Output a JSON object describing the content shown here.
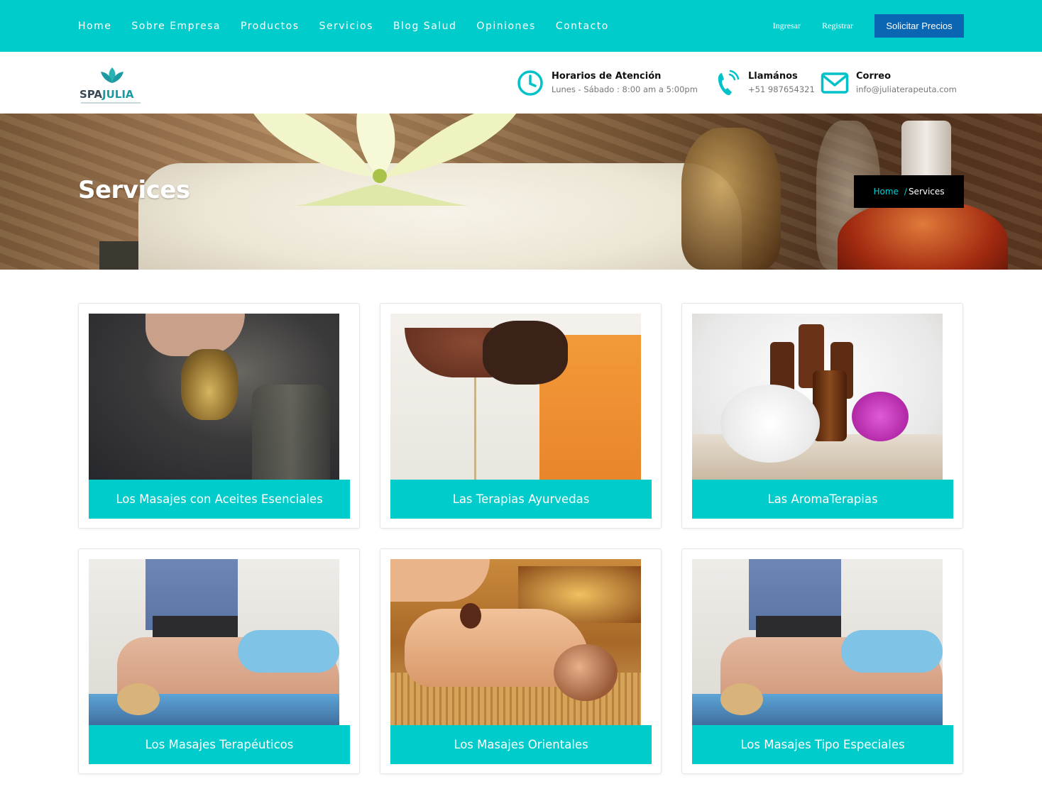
{
  "colors": {
    "brand": "#00cccc",
    "cta": "#0a66b3",
    "crumb_bg": "#000000",
    "crumb_accent": "#00d0d0"
  },
  "nav": {
    "items": [
      "Home",
      "Sobre Empresa",
      "Productos",
      "Servicios",
      "Blog Salud",
      "Opiniones",
      "Contacto"
    ],
    "login": "Ingresar",
    "register": "Registrar",
    "cta": "Solicitar Precios"
  },
  "logo": {
    "spa": "SPA",
    "julia": "JULIA",
    "icon": "lotus-icon"
  },
  "info": {
    "hours": {
      "icon": "clock-icon",
      "title": "Horarios de Atención",
      "detail": "Lunes - Sábado : 8:00 am a 5:00pm"
    },
    "phone": {
      "icon": "phone-icon",
      "title": "Llamános",
      "detail": "+51 987654321"
    },
    "email": {
      "icon": "envelope-icon",
      "title": "Correo",
      "detail": "info@juliaterapeuta.com"
    }
  },
  "hero": {
    "title": "Services",
    "breadcrumb": {
      "home": "Home",
      "separator": "/",
      "current": "Services"
    }
  },
  "services": [
    {
      "label": "Los Masajes con Aceites Esenciales",
      "image": "oil-pouring-photo"
    },
    {
      "label": "Las Terapias Ayurvedas",
      "image": "ayurveda-oil-bowl-photo"
    },
    {
      "label": "Las AromaTerapias",
      "image": "essential-oil-bottles-flowers-photo"
    },
    {
      "label": "Los Masajes Terapéuticos",
      "image": "back-massage-photo"
    },
    {
      "label": "Los Masajes Orientales",
      "image": "oriental-massage-photo"
    },
    {
      "label": "Los Masajes Tipo Especiales",
      "image": "back-massage-photo"
    }
  ]
}
